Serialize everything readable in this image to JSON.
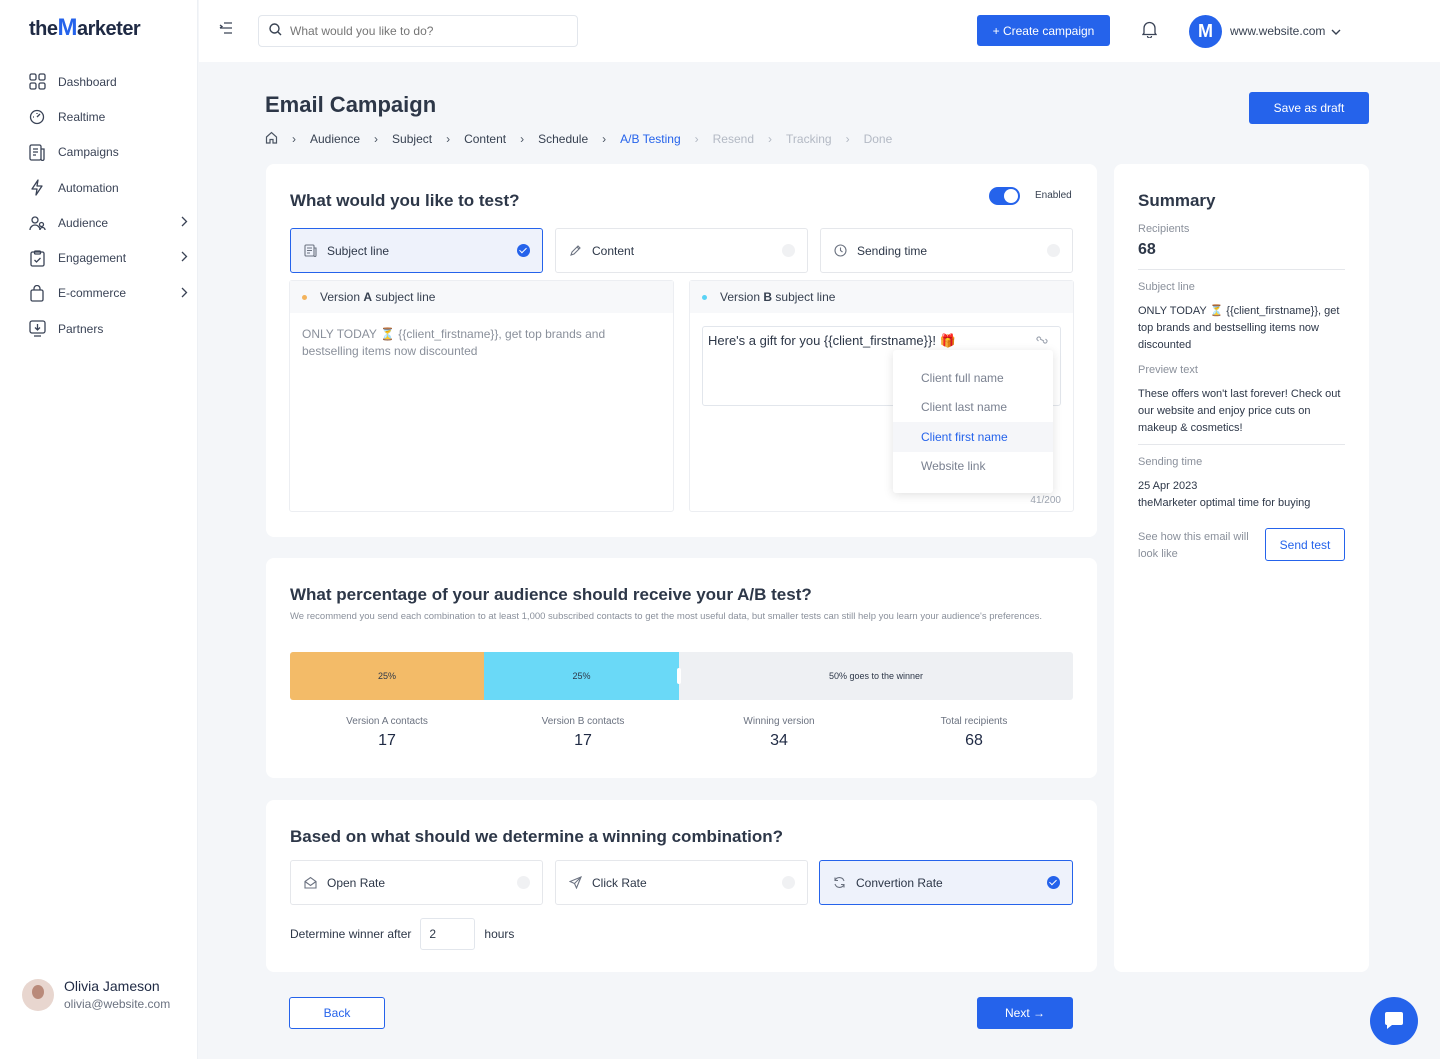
{
  "brand": {
    "logo_prefix": "the",
    "logo_m": "M",
    "logo_suffix": "arketer",
    "accent": "#2563eb"
  },
  "sidebar": {
    "items": [
      {
        "label": "Dashboard",
        "icon": "grid-icon"
      },
      {
        "label": "Realtime",
        "icon": "gauge-icon"
      },
      {
        "label": "Campaigns",
        "icon": "document-icon"
      },
      {
        "label": "Automation",
        "icon": "lightning-icon"
      },
      {
        "label": "Audience",
        "icon": "users-icon"
      },
      {
        "label": "Engagement",
        "icon": "clipboard-icon"
      },
      {
        "label": "E-commerce",
        "icon": "bag-icon"
      },
      {
        "label": "Partners",
        "icon": "partners-icon"
      }
    ],
    "user": {
      "name": "Olivia Jameson",
      "email": "olivia@website.com"
    }
  },
  "header": {
    "search_placeholder": "What would you like to do?",
    "create_label": "+ Create campaign",
    "site_logo": "M",
    "site": "www.website.com"
  },
  "page": {
    "title": "Email Campaign",
    "save_draft": "Save as draft",
    "breadcrumb": [
      "Audience",
      "Subject",
      "Content",
      "Schedule",
      "A/B Testing",
      "Resend",
      "Tracking",
      "Done"
    ]
  },
  "test_card": {
    "title": "What would you like to test?",
    "toggle_label": "Enabled",
    "options": [
      "Subject line",
      "Content",
      "Sending time"
    ],
    "version_a": {
      "prefix": "Version ",
      "letter": "A",
      "suffix": " subject line",
      "text": "ONLY TODAY ⏳ {{client_firstname}}, get top brands and bestselling items now discounted",
      "dot_color": "#f3b35c"
    },
    "version_b": {
      "prefix": "Version ",
      "letter": "B",
      "suffix": " subject line",
      "text": "Here's a gift for you {{client_firstname}}! 🎁",
      "dot_color": "#5ad3f5",
      "count": "41/200"
    },
    "dropdown": [
      "Client full name",
      "Client last name",
      "Client first name",
      "Website link"
    ]
  },
  "percentage_card": {
    "title": "What percentage of your audience should receive your A/B test?",
    "subtitle": "We recommend you send each combination to at least 1,000 subscribed contacts to get the most useful data, but smaller tests can still help you learn your audience's preferences.",
    "seg_a": "25%",
    "seg_b": "25%",
    "seg_rest": "50% goes to the winner",
    "seg_a_color": "#f3bb68",
    "seg_b_color": "#6ad9f7",
    "stats": [
      {
        "label": "Version A contacts",
        "value": "17"
      },
      {
        "label": "Version B contacts",
        "value": "17"
      },
      {
        "label": "Winning version",
        "value": "34"
      },
      {
        "label": "Total recipients",
        "value": "68"
      }
    ]
  },
  "winner_card": {
    "title": "Based on what should we determine a winning combination?",
    "options": [
      "Open Rate",
      "Click Rate",
      "Convertion Rate"
    ],
    "determine_label": "Determine winner after",
    "hours_value": "2",
    "hours_label": "hours"
  },
  "summary": {
    "title": "Summary",
    "recipients_label": "Recipients",
    "recipients": "68",
    "subject_label": "Subject line",
    "subject": "ONLY TODAY ⏳ {{client_firstname}}, get top brands and bestselling items now discounted",
    "preview_label": "Preview text",
    "preview": "These offers won't last forever! Check out our website and enjoy price cuts on makeup & cosmetics!",
    "sending_label": "Sending time",
    "sending_date": "25 Apr 2023",
    "sending_note": "theMarketer optimal time for buying",
    "test_note": "See how this email will look like",
    "send_test": "Send test"
  },
  "footer": {
    "back": "Back",
    "next": "Next →"
  }
}
